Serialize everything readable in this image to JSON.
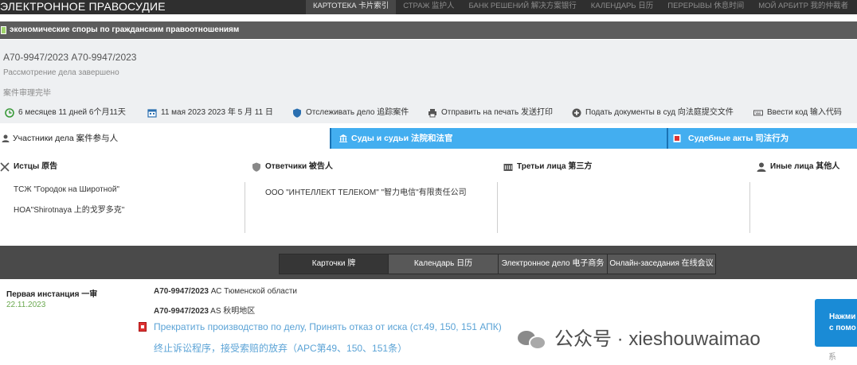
{
  "app": {
    "logo": "ЭЛЕКТРОННОЕ ПРАВОСУДИЕ"
  },
  "nav": [
    {
      "label": "КАРТОТЕКА 卡片索引",
      "active": true
    },
    {
      "label": "СТРАЖ 监护人",
      "active": false
    },
    {
      "label": "БАНК РЕШЕНИЙ 解决方案银行",
      "active": false
    },
    {
      "label": "КАЛЕНДАРЬ 日历",
      "active": false
    },
    {
      "label": "ПЕРЕРЫВЫ 休息时间",
      "active": false
    },
    {
      "label": "МОЙ АРБИТР 我的仲裁者",
      "active": false
    }
  ],
  "category": "экономические споры по гражданским правоотношениям",
  "case": {
    "number": "А70-9947/2023  A70-9947/2023",
    "status_ru": "Рассмотрение дела завершено",
    "status_zh": "案件审理完毕"
  },
  "tools": {
    "duration": "6 месяцев 11 дней  6个月11天",
    "date": "11 мая 2023 2023 年 5 月 11 日",
    "track": "Отслеживать дело 追踪案件",
    "print": "Отправить на печать 发送打印",
    "submit": "Подать документы в суд 向法庭提交文件",
    "code": "Ввести код 输入代码"
  },
  "tabs": {
    "participants": "Участники дела  案件参与人",
    "courts": "Суды и судьи  法院和法官",
    "acts": "Судебные акты  司法行为"
  },
  "participants": {
    "plaintiffs": {
      "title": "Истцы  原告",
      "items": [
        "ТСЖ \"Городок на Широтной\"",
        "HOA\"Shirotnaya 上的戈罗多克\""
      ]
    },
    "defendants": {
      "title": "Ответчики  被告人",
      "items": [
        "ООО \"ИНТЕЛЛЕКТ ТЕЛЕКОМ\"  \"智力电信\"有限责任公司"
      ]
    },
    "third": {
      "title": "Третьи лица  第三方"
    },
    "others": {
      "title": "Иные лица  其他人"
    }
  },
  "bottom_tabs": [
    {
      "label": "Карточки 牌",
      "active": true
    },
    {
      "label": "Календарь 日历",
      "active": false
    },
    {
      "label": "Электронное дело 电子商务",
      "active": false
    },
    {
      "label": "Онлайн-заседания 在线会议",
      "active": false
    }
  ],
  "instance": {
    "title": "Первая инстанция  一审",
    "date": "22.11.2023",
    "line1_num": "А70-9947/2023",
    "line1_court": " АС Тюменской области",
    "line2_num": "A70-9947/2023",
    "line2_court": " AS 秋明地区",
    "act_ru": "Прекратить производство по делу, Принять отказ от иска (ст.49, 150, 151 АПК)",
    "act_zh": "终止诉讼程序，接受索赔的放弃（APC第49、150、151条）"
  },
  "side_button": {
    "line1": "Нажми",
    "line2": "с помо"
  },
  "watermark": {
    "text": "公众号 · xieshouwaimao",
    "sub": "系"
  }
}
